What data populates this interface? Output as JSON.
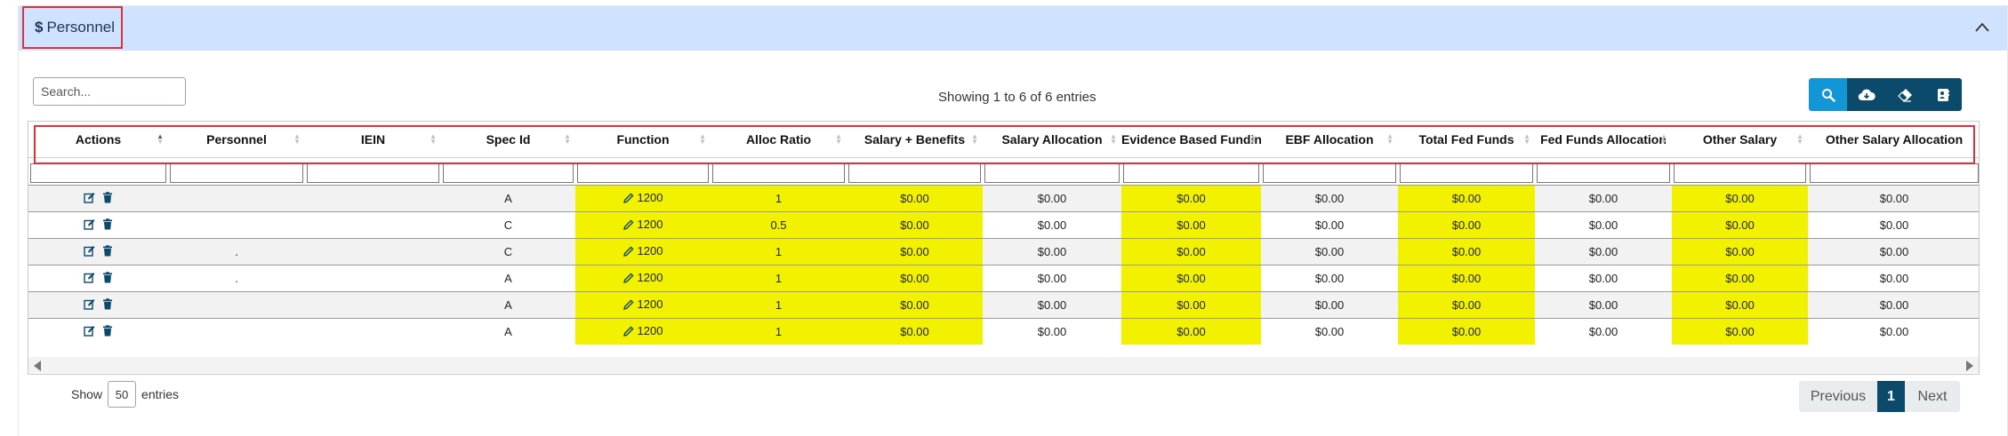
{
  "panel": {
    "title_symbol": "$",
    "title": "Personnel"
  },
  "search": {
    "placeholder": "Search..."
  },
  "info": "Showing 1 to 6 of 6 entries",
  "toolbar": {
    "buttons": [
      "search-icon",
      "cloud-download-icon",
      "eraser-icon",
      "address-card-icon"
    ]
  },
  "table": {
    "columns": [
      "Actions",
      "Personnel",
      "IEIN",
      "Spec Id",
      "Function",
      "Alloc Ratio",
      "Salary + Benefits",
      "Salary Allocation",
      "Evidence Based Funding",
      "EBF Allocation",
      "Total Fed Funds",
      "Fed Funds Allocation",
      "Other Salary",
      "Other Salary Allocation"
    ],
    "rows": [
      {
        "personnel": "",
        "iein": "",
        "spec_id": "A",
        "function": "1200",
        "alloc_ratio": "1",
        "salary_benefits": "$0.00",
        "salary_allocation": "$0.00",
        "ebf": "$0.00",
        "ebf_allocation": "$0.00",
        "total_fed_funds": "$0.00",
        "fed_funds_allocation": "$0.00",
        "other_salary": "$0.00",
        "other_salary_allocation": "$0.00"
      },
      {
        "personnel": "",
        "iein": "",
        "spec_id": "C",
        "function": "1200",
        "alloc_ratio": "0.5",
        "salary_benefits": "$0.00",
        "salary_allocation": "$0.00",
        "ebf": "$0.00",
        "ebf_allocation": "$0.00",
        "total_fed_funds": "$0.00",
        "fed_funds_allocation": "$0.00",
        "other_salary": "$0.00",
        "other_salary_allocation": "$0.00"
      },
      {
        "personnel": ".",
        "iein": "",
        "spec_id": "C",
        "function": "1200",
        "alloc_ratio": "1",
        "salary_benefits": "$0.00",
        "salary_allocation": "$0.00",
        "ebf": "$0.00",
        "ebf_allocation": "$0.00",
        "total_fed_funds": "$0.00",
        "fed_funds_allocation": "$0.00",
        "other_salary": "$0.00",
        "other_salary_allocation": "$0.00"
      },
      {
        "personnel": ".",
        "iein": "",
        "spec_id": "A",
        "function": "1200",
        "alloc_ratio": "1",
        "salary_benefits": "$0.00",
        "salary_allocation": "$0.00",
        "ebf": "$0.00",
        "ebf_allocation": "$0.00",
        "total_fed_funds": "$0.00",
        "fed_funds_allocation": "$0.00",
        "other_salary": "$0.00",
        "other_salary_allocation": "$0.00"
      },
      {
        "personnel": "",
        "iein": "",
        "spec_id": "A",
        "function": "1200",
        "alloc_ratio": "1",
        "salary_benefits": "$0.00",
        "salary_allocation": "$0.00",
        "ebf": "$0.00",
        "ebf_allocation": "$0.00",
        "total_fed_funds": "$0.00",
        "fed_funds_allocation": "$0.00",
        "other_salary": "$0.00",
        "other_salary_allocation": "$0.00"
      },
      {
        "personnel": "",
        "iein": "",
        "spec_id": "A",
        "function": "1200",
        "alloc_ratio": "1",
        "salary_benefits": "$0.00",
        "salary_allocation": "$0.00",
        "ebf": "$0.00",
        "ebf_allocation": "$0.00",
        "total_fed_funds": "$0.00",
        "fed_funds_allocation": "$0.00",
        "other_salary": "$0.00",
        "other_salary_allocation": "$0.00"
      }
    ]
  },
  "footer": {
    "show_label": "Show",
    "page_size": "50",
    "entries_label": "entries"
  },
  "pagination": {
    "previous": "Previous",
    "current": "1",
    "next": "Next"
  },
  "colors": {
    "header_bg": "#cfe2ff",
    "highlight": "#f2f200",
    "primary": "#0b4a6b",
    "active_button": "#1296d6",
    "outline": "#e0313b"
  }
}
